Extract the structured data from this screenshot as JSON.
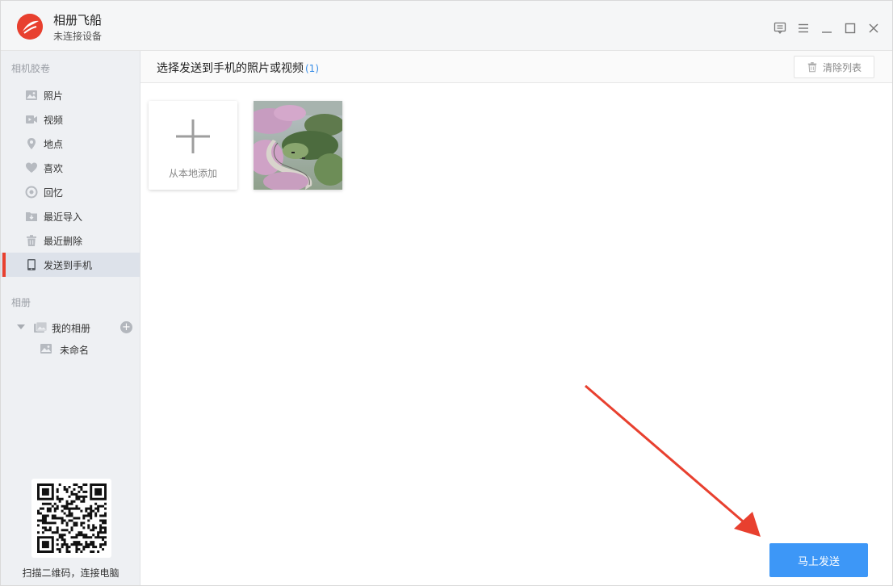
{
  "app": {
    "title": "相册飞船",
    "status": "未连接设备"
  },
  "sidebar": {
    "roll_section": "相机胶卷",
    "items": [
      {
        "label": "照片",
        "icon": "photo-icon"
      },
      {
        "label": "视频",
        "icon": "video-icon"
      },
      {
        "label": "地点",
        "icon": "location-icon"
      },
      {
        "label": "喜欢",
        "icon": "heart-icon"
      },
      {
        "label": "回忆",
        "icon": "memory-icon"
      },
      {
        "label": "最近导入",
        "icon": "import-icon"
      },
      {
        "label": "最近删除",
        "icon": "trash-icon"
      },
      {
        "label": "发送到手机",
        "icon": "phone-icon",
        "active": true
      }
    ],
    "album_section": "相册",
    "album_root": "我的相册",
    "album_children": [
      "未命名"
    ],
    "qr_caption": "扫描二维码，连接电脑"
  },
  "main": {
    "title": "选择发送到手机的照片或视频",
    "count": "(1)",
    "clear_label": "清除列表",
    "add_label": "从本地添加",
    "send_label": "马上发送"
  },
  "colors": {
    "accent": "#e8402f",
    "primary_button": "#3d97f7",
    "count_text": "#3a8ee6"
  }
}
